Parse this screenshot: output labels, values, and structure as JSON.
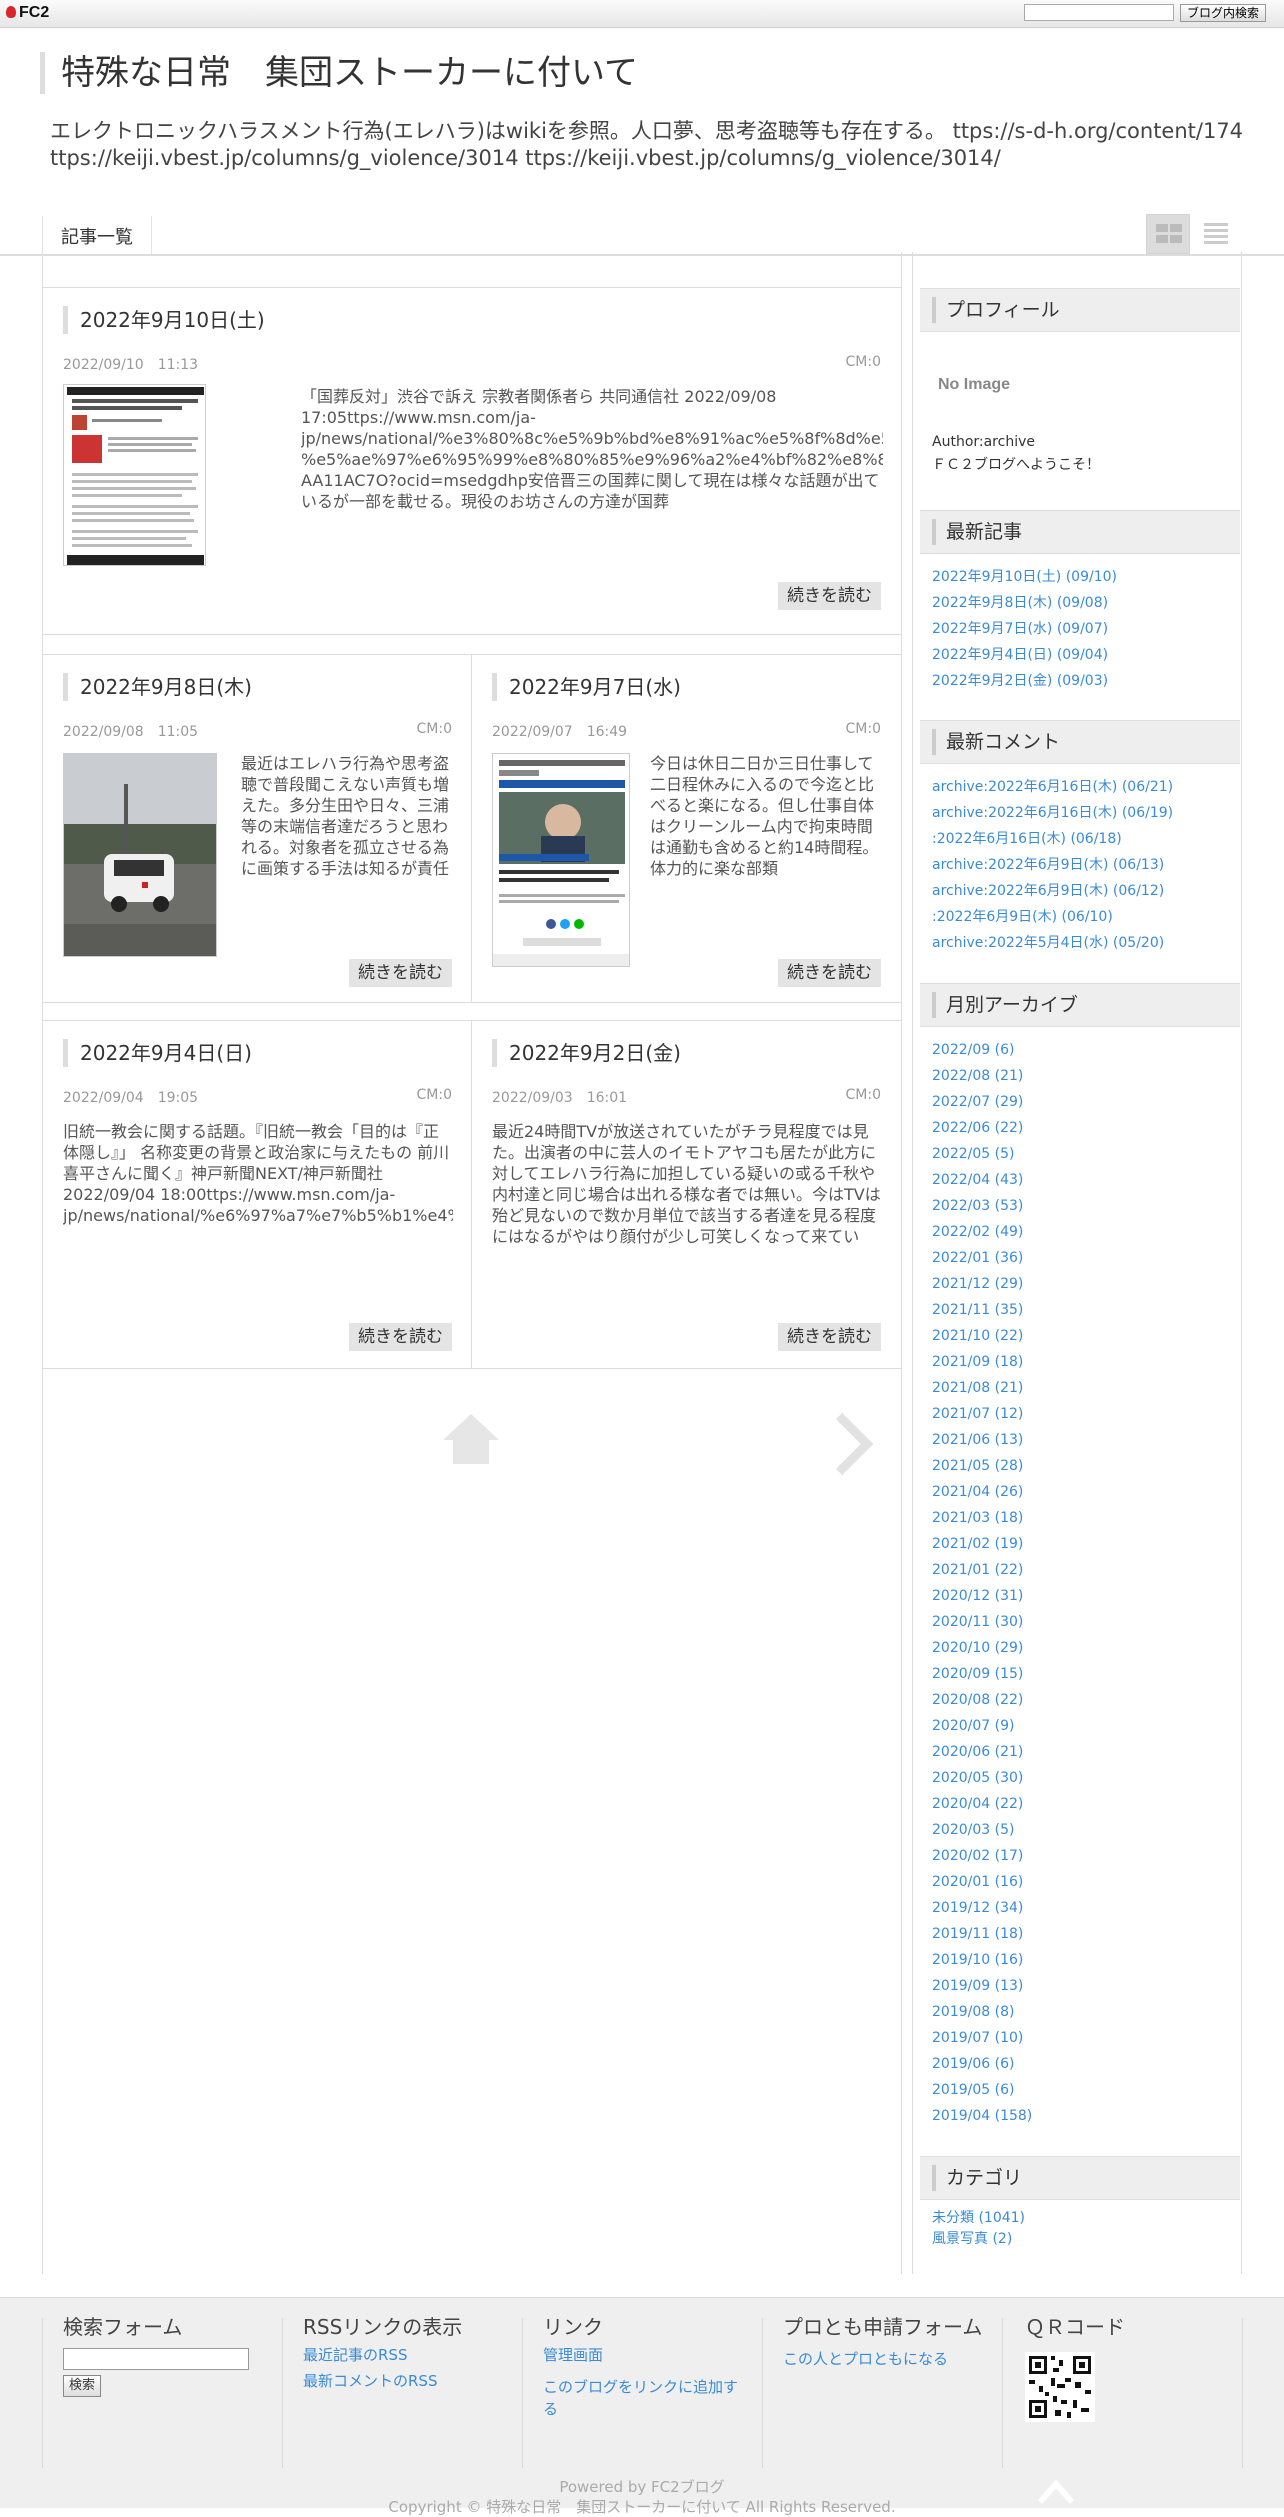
{
  "fc2bar": {
    "logo": "FC2",
    "search_button": "ブログ内検索"
  },
  "header": {
    "title": "特殊な日常　集団ストーカーに付いて",
    "description": "エレクトロニックハラスメント行為(エレハラ)はwikiを参照。人口夢、思考盗聴等も存在する。 ttps://s-d-h.org/content/174 ttps://keiji.vbest.jp/columns/g_violence/3014 ttps://keiji.vbest.jp/columns/g_violence/3014/"
  },
  "nav": {
    "item": "記事一覧"
  },
  "entries": [
    {
      "title": "2022年9月10日(土)",
      "date": "2022/09/10　11:13",
      "cm": "CM:0",
      "body": "「国葬反対」渋谷で訴え 宗教者関係者ら 共同通信社 2022/09/08 17:05ttps://www.msn.com/ja-jp/news/national/%e3%80%8c%e5%9b%bd%e8%91%ac%e5%8f%8d%e5%af%be%e3%80%8d%e6%b8%8b%e8%b0%b7%e3%81%a7%e8%a8%b4%e3%81%88-%e5%ae%97%e6%95%99%e8%80%85%e9%96%a2%e4%bf%82%e8%80%85%e3%82%89/ar-AA11AC7O?ocid=msedgdhp安倍晋三の国葬に関して現在は様々な話題が出ているが一部を載せる。現役のお坊さんの方達が国葬",
      "readmore": "続きを読む"
    },
    {
      "title": "2022年9月8日(木)",
      "date": "2022/09/08　11:05",
      "cm": "CM:0",
      "body": "最近はエレハラ行為や思考盗聴で普段聞こえない声質も増えた。多分生田や日々、三浦等の末端信者達だろうと思われる。対象者を孤立させる為に画策する手法は知るが責任",
      "readmore": "続きを読む"
    },
    {
      "title": "2022年9月7日(水)",
      "date": "2022/09/07　16:49",
      "cm": "CM:0",
      "body": "今日は休日二日か三日仕事して二日程休みに入るので今迄と比べると楽になる。但し仕事自体はクリーンルーム内で拘束時間は通勤も含めると約14時間程。体力的に楽な部類",
      "readmore": "続きを読む"
    },
    {
      "title": "2022年9月4日(日)",
      "date": "2022/09/04　19:05",
      "cm": "CM:0",
      "body": "旧統一教会に関する話題。『旧統一教会「目的は『正体隠し』」 名称変更の背景と政治家に与えたもの 前川喜平さんに聞く』神戸新聞NEXT/神戸新聞社 2022/09/04 18:00ttps://www.msn.com/ja-jp/news/national/%e6%97%a7%e7%b5%b1%e4%b8%80%e6%95%99%e4%bc%9a%e3%80%8c%e7%9b%ae%e7%9a%84%e",
      "readmore": "続きを読む"
    },
    {
      "title": "2022年9月2日(金)",
      "date": "2022/09/03　16:01",
      "cm": "CM:0",
      "body": "最近24時間TVが放送されていたがチラ見程度では見た。出演者の中に芸人のイモトアヤコも居たが此方に対してエレハラ行為に加担している疑いの或る千秋や内村達と同じ場合は出れる様な者では無い。今はTVは殆ど見ないので数か月単位で該当する者達を見る程度にはなるがやはり顔付が少し可笑しくなって来てい",
      "readmore": "続きを読む"
    }
  ],
  "profile": {
    "title": "プロフィール",
    "no_image": "No Image",
    "author": "Author:archive",
    "message": "ＦＣ２ブログへようこそ！"
  },
  "recent_entries": {
    "title": "最新記事",
    "items": [
      "2022年9月10日(土) (09/10)",
      "2022年9月8日(木) (09/08)",
      "2022年9月7日(水) (09/07)",
      "2022年9月4日(日) (09/04)",
      "2022年9月2日(金) (09/03)"
    ]
  },
  "recent_comments": {
    "title": "最新コメント",
    "items": [
      "archive:2022年6月16日(木) (06/21)",
      "archive:2022年6月16日(木) (06/19)",
      ":2022年6月16日(木) (06/18)",
      "archive:2022年6月9日(木) (06/13)",
      "archive:2022年6月9日(木) (06/12)",
      ":2022年6月9日(木) (06/10)",
      "archive:2022年5月4日(水) (05/20)"
    ]
  },
  "archives": {
    "title": "月別アーカイブ",
    "items": [
      "2022/09 (6)",
      "2022/08 (21)",
      "2022/07 (29)",
      "2022/06 (22)",
      "2022/05 (5)",
      "2022/04 (43)",
      "2022/03 (53)",
      "2022/02 (49)",
      "2022/01 (36)",
      "2021/12 (29)",
      "2021/11 (35)",
      "2021/10 (22)",
      "2021/09 (18)",
      "2021/08 (21)",
      "2021/07 (12)",
      "2021/06 (13)",
      "2021/05 (28)",
      "2021/04 (26)",
      "2021/03 (18)",
      "2021/02 (19)",
      "2021/01 (22)",
      "2020/12 (31)",
      "2020/11 (30)",
      "2020/10 (29)",
      "2020/09 (15)",
      "2020/08 (22)",
      "2020/07 (9)",
      "2020/06 (21)",
      "2020/05 (30)",
      "2020/04 (22)",
      "2020/03 (5)",
      "2020/02 (17)",
      "2020/01 (16)",
      "2019/12 (34)",
      "2019/11 (18)",
      "2019/10 (16)",
      "2019/09 (13)",
      "2019/08 (8)",
      "2019/07 (10)",
      "2019/06 (6)",
      "2019/05 (6)",
      "2019/04 (158)"
    ]
  },
  "categories": {
    "title": "カテゴリ",
    "items": [
      "未分類 (1041)",
      "風景写真 (2)"
    ]
  },
  "footer": {
    "search": {
      "title": "検索フォーム",
      "button": "検索"
    },
    "rss": {
      "title": "RSSリンクの表示",
      "links": [
        "最近記事のRSS",
        "最新コメントのRSS"
      ]
    },
    "links": {
      "title": "リンク",
      "links": [
        "管理画面",
        "このブログをリンクに追加する"
      ]
    },
    "protomo": {
      "title": "プロとも申請フォーム",
      "link": "この人とプロともになる"
    },
    "qr": {
      "title": "ＱＲコード"
    },
    "powered": "Powered by FC2ブログ",
    "copyright": "Copyright © 特殊な日常　集団ストーカーに付いて All Rights Reserved."
  }
}
